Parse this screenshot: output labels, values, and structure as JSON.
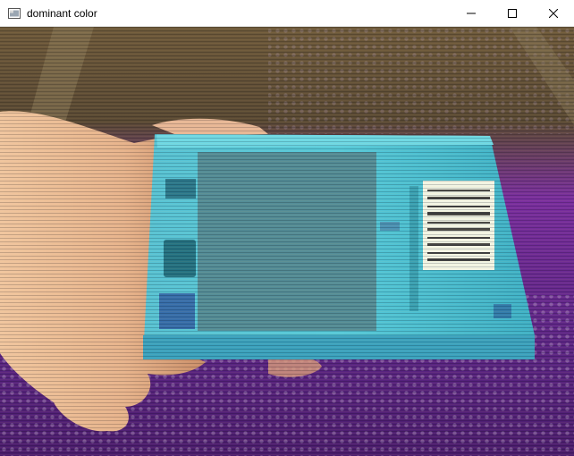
{
  "window": {
    "title": "dominant color"
  },
  "title_icon": "opencv-window-icon",
  "controls": {
    "minimize_icon": "minimize-icon",
    "maximize_icon": "maximize-icon",
    "close_icon": "close-icon"
  },
  "frame": {
    "scene_colors": {
      "background_top": "#6e5a3c",
      "background_mid": "#7a2fa0",
      "background_bottom": "#4b1d6e",
      "hand": "#e7b48e",
      "box_body": "#55c8d8",
      "box_edge": "#6fd9e6",
      "box_bottom_band": "#3ba3c0",
      "barcode_bg": "#f2f5e6",
      "dominant_patch": "#548d98"
    },
    "dominant_color_hex": "#548d98"
  }
}
